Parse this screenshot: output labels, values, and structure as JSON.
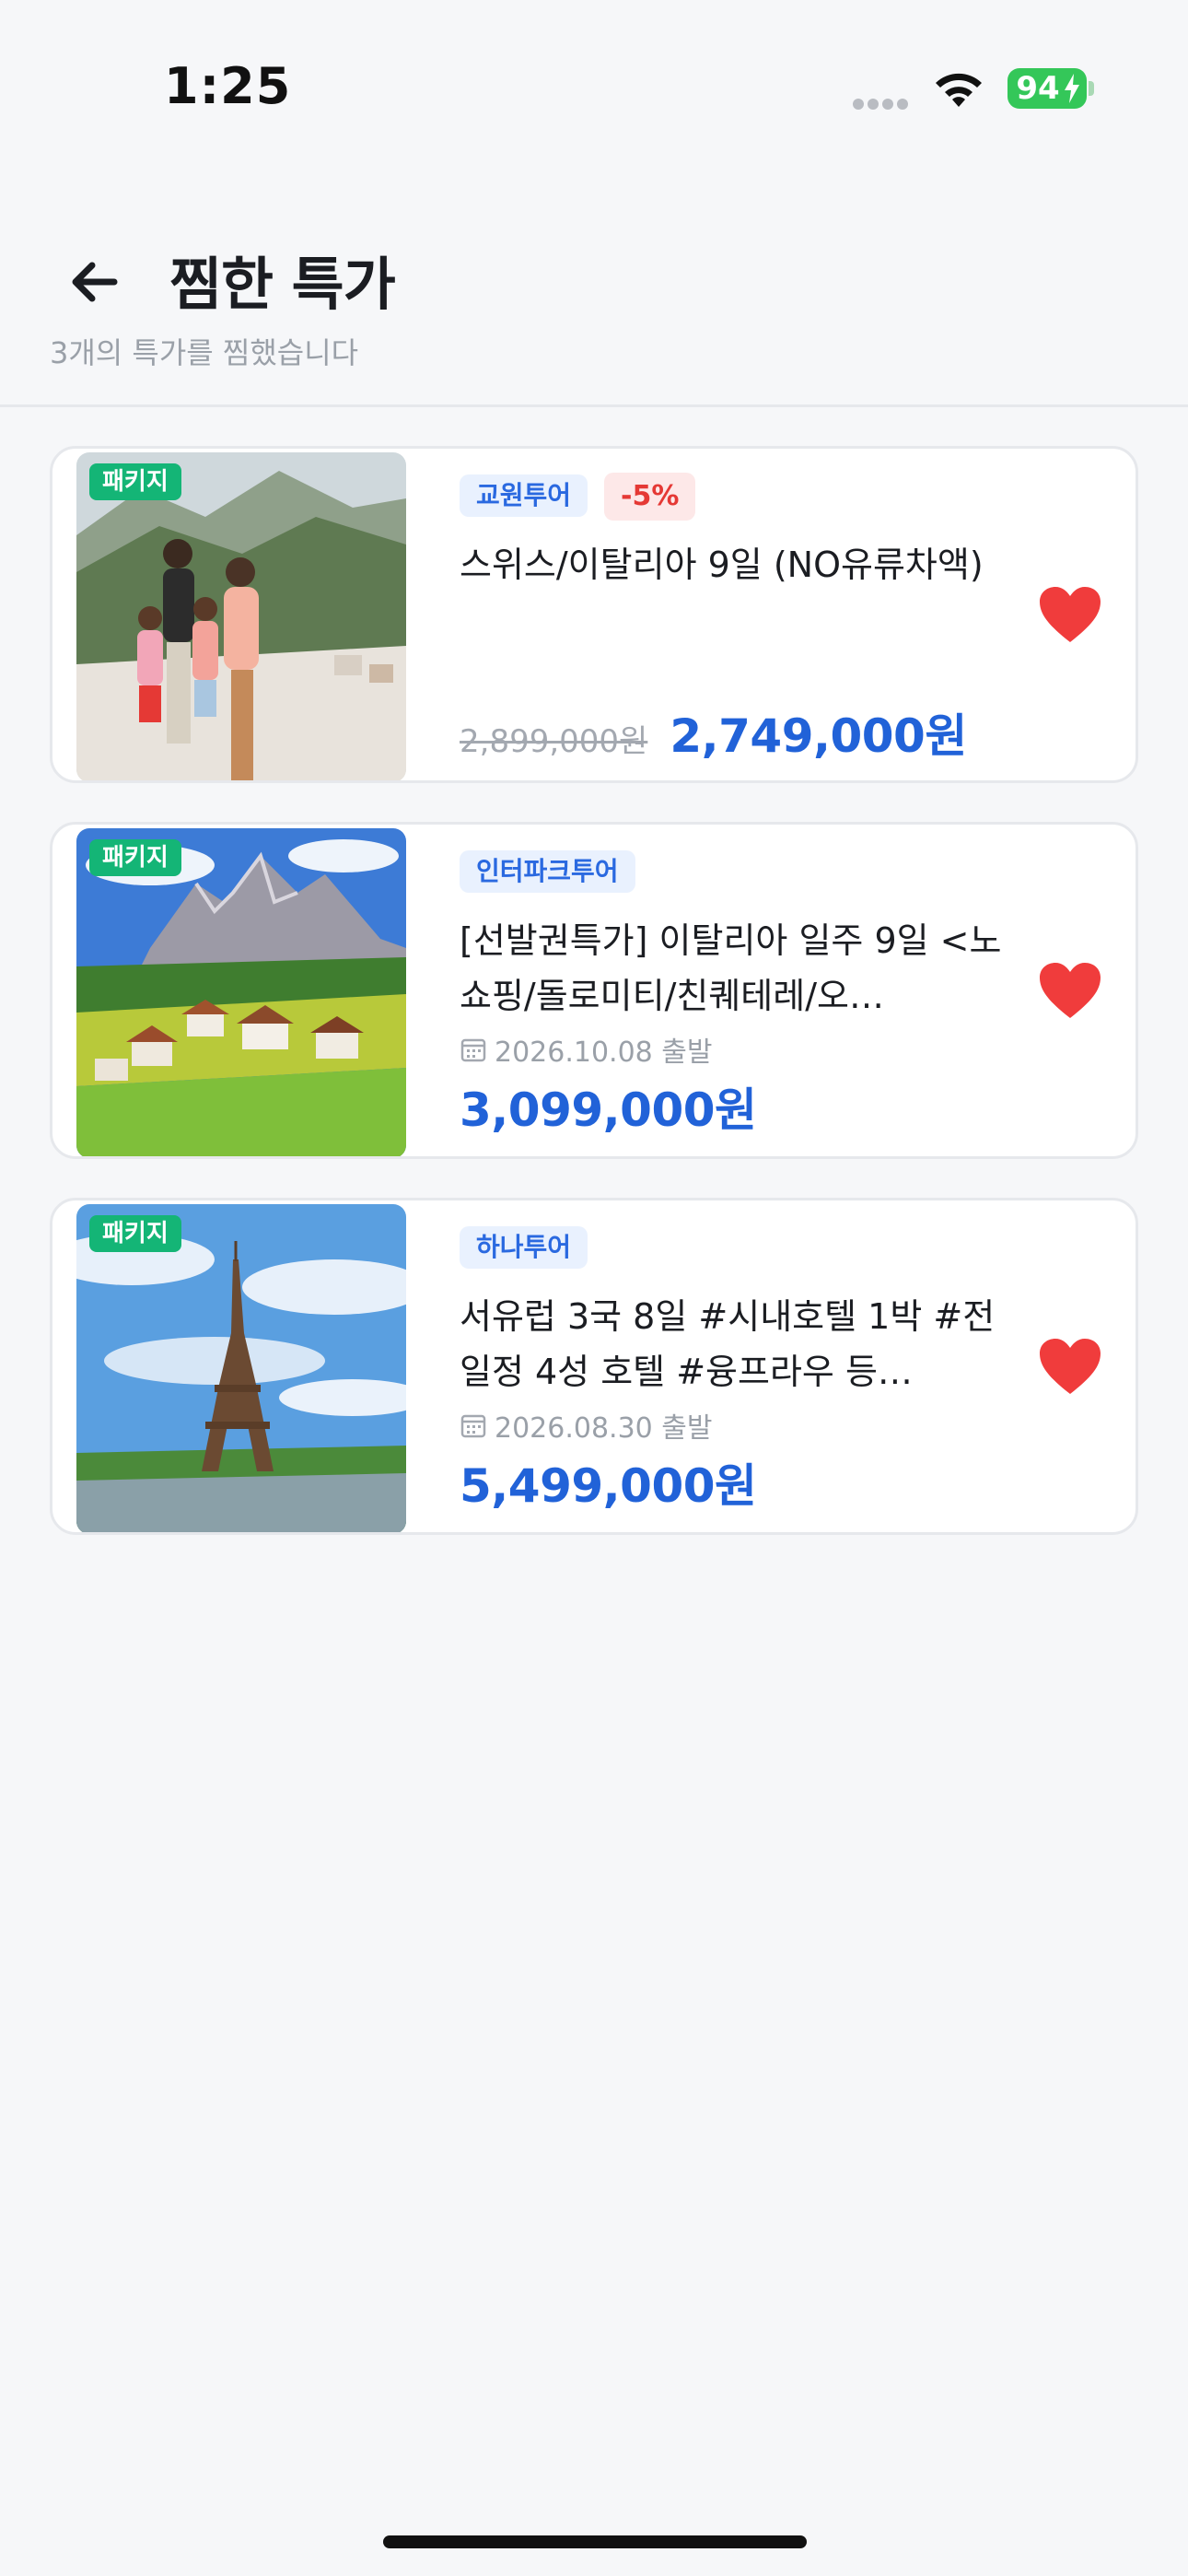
{
  "status_bar": {
    "time": "1:25",
    "battery": "94",
    "icons": [
      "signal-dots-icon",
      "wifi-icon",
      "battery-charging-icon"
    ]
  },
  "header": {
    "title": "찜한 특가",
    "subtitle": "3개의 특가를 찜했습니다",
    "back_icon": "arrow-left-icon"
  },
  "colors": {
    "accent_blue": "#2162d8",
    "package_badge_green": "#14b576",
    "heart_red": "#f03c3c",
    "discount_red": "#e53935"
  },
  "deals": [
    {
      "badge": "패키지",
      "agency": "교원투어",
      "discount": "-5%",
      "title": "스위스/이탈리아 9일 (NO유류차액)",
      "date": "",
      "original_price": "2,899,000원",
      "price": "2,749,000원",
      "favorited": true
    },
    {
      "badge": "패키지",
      "agency": "인터파크투어",
      "discount": "",
      "title": "[선발권특가] 이탈리아 일주 9일 <노쇼핑/돌로미티/친퀘테레/오…",
      "date": "2026.10.08 출발",
      "original_price": "",
      "price": "3,099,000원",
      "favorited": true
    },
    {
      "badge": "패키지",
      "agency": "하나투어",
      "discount": "",
      "title": "서유럽 3국 8일 #시내호텔 1박 #전 일정 4성 호텔 #융프라우 등…",
      "date": "2026.08.30 출발",
      "original_price": "",
      "price": "5,499,000원",
      "favorited": true
    }
  ]
}
